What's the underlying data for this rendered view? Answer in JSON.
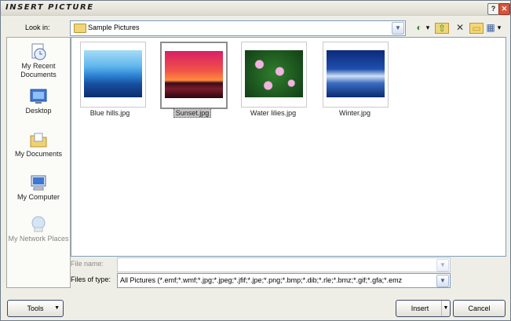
{
  "window": {
    "title": "INSERT PICTURE",
    "help_glyph": "?",
    "close_glyph": "✕"
  },
  "lookin": {
    "label": "Look in:",
    "value": "Sample Pictures"
  },
  "toolbar": [
    {
      "name": "back-icon",
      "glyph": "◐"
    },
    {
      "name": "dropdown-arrow-icon",
      "glyph": "▾"
    },
    {
      "name": "up-folder-icon",
      "glyph": "⇧"
    },
    {
      "name": "delete-icon",
      "glyph": "✕"
    },
    {
      "name": "new-folder-icon",
      "glyph": "▭"
    },
    {
      "name": "views-icon",
      "glyph": "▦"
    },
    {
      "name": "views-arrow-icon",
      "glyph": "▾"
    }
  ],
  "places": [
    {
      "name": "my-recent-documents",
      "label": "My Recent Documents",
      "icon": "recent-documents-icon"
    },
    {
      "name": "desktop",
      "label": "Desktop",
      "icon": "desktop-icon"
    },
    {
      "name": "my-documents",
      "label": "My Documents",
      "icon": "my-documents-icon"
    },
    {
      "name": "my-computer",
      "label": "My Computer",
      "icon": "my-computer-icon"
    },
    {
      "name": "my-network-places",
      "label": "My Network Places",
      "icon": "network-places-icon"
    }
  ],
  "files": [
    {
      "name": "Blue hills.jpg",
      "selected": false
    },
    {
      "name": "Sunset.jpg",
      "selected": true
    },
    {
      "name": "Water lilies.jpg",
      "selected": false
    },
    {
      "name": "Winter.jpg",
      "selected": false
    }
  ],
  "filename": {
    "label": "File name:",
    "value": ""
  },
  "filetype": {
    "label": "Files of type:",
    "value": "All Pictures (*.emf;*.wmf;*.jpg;*.jpeg;*.jfif;*.jpe;*.png;*.bmp;*.dib;*.rle;*.bmz;*.gif;*.gfa;*.emz"
  },
  "buttons": {
    "tools": "Tools",
    "insert": "Insert",
    "cancel": "Cancel"
  }
}
